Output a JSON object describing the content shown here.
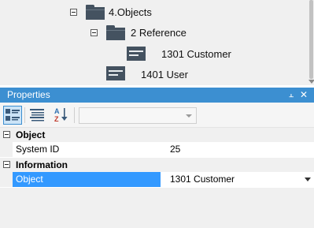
{
  "tree": {
    "items": [
      {
        "label": "4.Objects",
        "icon": "folder-icon",
        "expanded": true
      },
      {
        "label": "2 Reference",
        "icon": "folder-icon",
        "expanded": true
      },
      {
        "label": "1301 Customer",
        "icon": "table-icon"
      },
      {
        "label": "1401 User",
        "icon": "table-icon"
      }
    ]
  },
  "properties": {
    "title": "Properties",
    "pin_glyph": "⫠",
    "close_glyph": "✕",
    "toolbar": {
      "buttons": [
        "categorized-icon",
        "alphabetical-icon",
        "sort-az-icon"
      ],
      "object_selector_value": ""
    },
    "categories": [
      {
        "label": "Object",
        "rows": [
          {
            "name": "System ID",
            "value": "25"
          }
        ]
      },
      {
        "label": "Information",
        "rows": [
          {
            "name": "Object",
            "value": "1301 Customer",
            "selected": true
          }
        ]
      }
    ]
  },
  "colors": {
    "titlebar": "#3c8fd1",
    "selection": "#3399ff",
    "icon_fill": "#445260"
  }
}
